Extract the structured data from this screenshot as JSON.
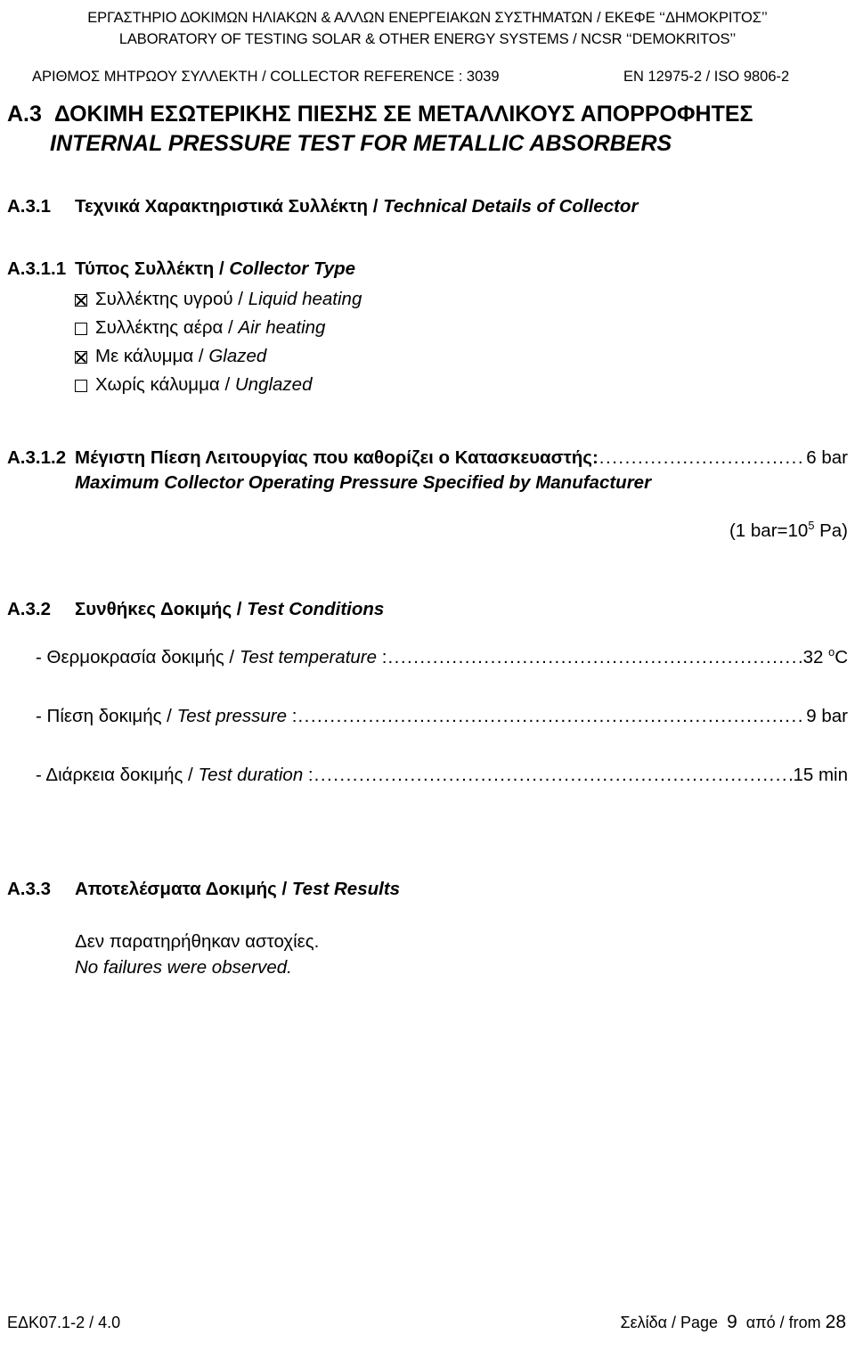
{
  "header": {
    "lab_gr": "ΕΡΓΑΣΤΗΡΙΟ ΔΟΚΙΜΩΝ ΗΛΙΑΚΩΝ & ΑΛΛΩΝ ΕΝΕΡΓΕΙΑΚΩΝ ΣΥΣΤΗΜΑΤΩΝ / ΕΚΕΦΕ ‘‘ΔΗΜΟΚΡΙΤΟΣ’’",
    "lab_en": "LABORATORY OF TESTING SOLAR & OTHER ENERGY SYSTEMS / NCSR ‘‘DEMOKRITOS’’",
    "collector_reference": "ΑΡΙΘΜΟΣ ΜΗΤΡΩΟΥ ΣΥΛΛΕΚΤΗ / COLLECTOR REFERENCE : 3039",
    "standard": "EN 12975-2 / ISO 9806-2"
  },
  "title": {
    "number": "Α.3",
    "gr": "ΔΟΚΙΜΗ ΕΣΩΤΕΡΙΚΗΣ ΠΙΕΣΗΣ ΣΕ ΜΕΤΑΛΛΙΚΟΥΣ ΑΠΟΡΡΟΦΗΤΕΣ",
    "en": "INTERNAL PRESSURE TEST FOR METALLIC ABSORBERS"
  },
  "sections": {
    "a311_parent": {
      "number": "Α.3.1",
      "gr": "Τεχνικά Χαρακτηριστικά Συλλέκτη /",
      "en": "Technical Details of Collector"
    },
    "a311": {
      "number": "Α.3.1.1",
      "gr": "Τύπος Συλλέκτη /",
      "en": "Collector Type",
      "options": [
        {
          "checked": true,
          "gr": "Συλλέκτης υγρού /",
          "en": "Liquid heating"
        },
        {
          "checked": false,
          "gr": "Συλλέκτης αέρα /",
          "en": "Air heating"
        },
        {
          "checked": true,
          "gr": "Με κάλυμμα /",
          "en": "Glazed"
        },
        {
          "checked": false,
          "gr": "Χωρίς κάλυμμα /",
          "en": "Unglazed"
        }
      ]
    },
    "a312": {
      "number": "Α.3.1.2",
      "gr": "Μέγιστη Πίεση Λειτουργίας που καθορίζει ο Κατασκευαστής:",
      "value": "6 bar",
      "en": "Maximum Collector Operating Pressure Specified by  Manufacturer",
      "unit_note_pre": "(1 bar=10",
      "unit_note_sup": "5",
      "unit_note_post": " Pa)"
    },
    "a32": {
      "number": "Α.3.2",
      "gr": "Συνθήκες Δοκιμής /",
      "en": "Test Conditions",
      "conditions": [
        {
          "gr": "- Θερμοκρασία δοκιμής /",
          "en": "Test temperature",
          "sep": " :",
          "value": "32 ",
          "value_sup": "o",
          "value_post": "C"
        },
        {
          "gr": "- Πίεση δοκιμής /",
          "en": "Test pressure",
          "sep": " :",
          "value": "9 bar",
          "value_sup": "",
          "value_post": ""
        },
        {
          "gr": "- Διάρκεια δοκιμής /",
          "en": "Test duration",
          "sep": " :",
          "value": "15 min",
          "value_sup": "",
          "value_post": ""
        }
      ]
    },
    "a33": {
      "number": "Α.3.3",
      "gr": "Αποτελέσματα Δοκιμής /",
      "en": "Test Results",
      "result_gr": "Δεν παρατηρήθηκαν αστοχίες.",
      "result_en": "No failures were observed."
    }
  },
  "footer": {
    "doc_code": "ΕΔΚ07.1-2 / 4.0",
    "page_label": "Σελίδα / Page",
    "page_number": "9",
    "of_label": "από / from",
    "total_pages": "28"
  }
}
